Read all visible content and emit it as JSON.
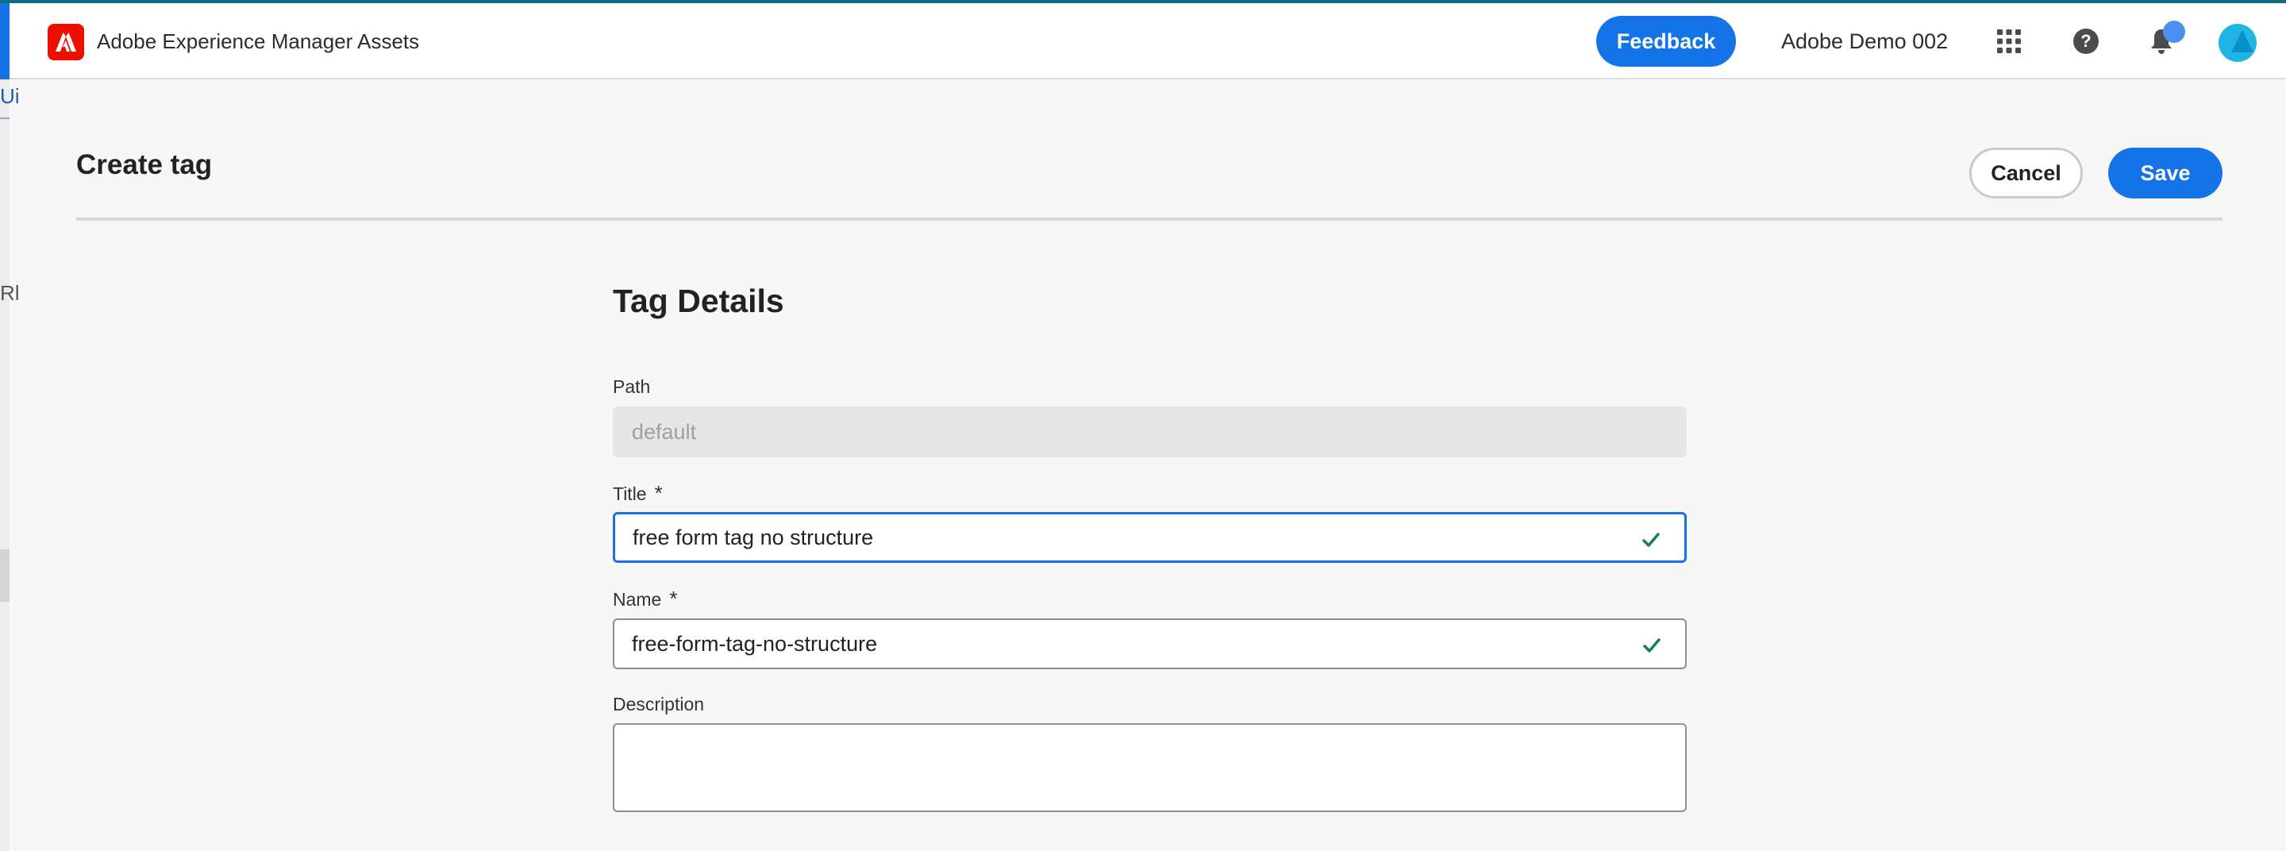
{
  "header": {
    "app_title": "Adobe Experience Manager Assets",
    "feedback_label": "Feedback",
    "org_name": "Adobe Demo 002",
    "icons": [
      "adobe-logo-icon",
      "apps-grid-icon",
      "help-icon",
      "notification-bell-icon",
      "user-avatar"
    ]
  },
  "underlying_app": {
    "fragment_top": "Ui",
    "fragment_mid": "Rl"
  },
  "page": {
    "title": "Create tag",
    "cancel_label": "Cancel",
    "save_label": "Save"
  },
  "form": {
    "section_title": "Tag Details",
    "path": {
      "label": "Path",
      "placeholder": "default",
      "value": ""
    },
    "title_field": {
      "label": "Title",
      "required_mark": "*",
      "value": "free form tag no structure",
      "valid": true
    },
    "name_field": {
      "label": "Name",
      "required_mark": "*",
      "value": "free-form-tag-no-structure",
      "valid": true
    },
    "description": {
      "label": "Description",
      "value": ""
    }
  },
  "colors": {
    "accent": "#1473e6",
    "brand_red": "#eb1000",
    "valid_check": "#12805c"
  }
}
